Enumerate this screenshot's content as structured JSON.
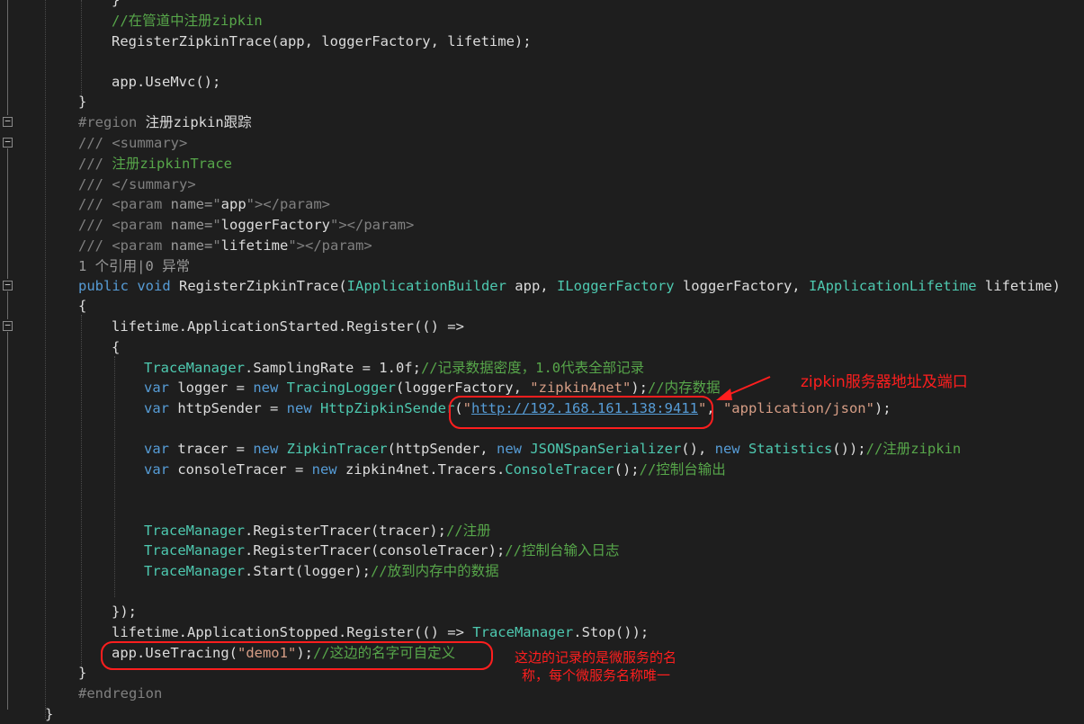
{
  "editor": {
    "lines": {
      "l0": "}",
      "l1": "//在管道中注册zipkin",
      "l2_a": "RegisterZipkinTrace(app, loggerFactory, lifetime);",
      "l4": "app.UseMvc();",
      "l5": "}",
      "l6_kw": "#region ",
      "l6_text": "注册zipkin跟踪",
      "l7_pre": "/// ",
      "l7_tag": "<summary>",
      "l8_pre": "/// ",
      "l8_text": "注册zipkinTrace",
      "l9_pre": "/// ",
      "l9_tag": "</summary>",
      "l10_pre": "/// ",
      "l10_a": "<param ",
      "l10_b": "name=",
      "l10_c": "\"",
      "l10_d": "app",
      "l10_e": "\"",
      "l10_f": "></param>",
      "l11_pre": "/// ",
      "l11_a": "<param ",
      "l11_b": "name=",
      "l11_c": "\"",
      "l11_d": "loggerFactory",
      "l11_e": "\"",
      "l11_f": "></param>",
      "l12_pre": "/// ",
      "l12_a": "<param ",
      "l12_b": "name=",
      "l12_c": "\"",
      "l12_d": "lifetime",
      "l12_e": "\"",
      "l12_f": "></param>",
      "codelens": "1 个引用|0 异常",
      "l14_pub": "public",
      "l14_void": "void",
      "l14_name": "RegisterZipkinTrace(",
      "l14_t1": "IApplicationBuilder",
      "l14_p1": " app, ",
      "l14_t2": "ILoggerFactory",
      "l14_p2": " loggerFactory, ",
      "l14_t3": "IApplicationLifetime",
      "l14_p3": " lifetime)",
      "l15": "{",
      "l16": "lifetime.ApplicationStarted.Register(() =>",
      "l17": "{",
      "l18_t": "TraceManager",
      "l18_a": ".SamplingRate = 1.0f;",
      "l18_c": "//记录数据密度，1.0代表全部记录",
      "l19_var": "var",
      "l19_a": " logger = ",
      "l19_new": "new",
      "l19_t": " TracingLogger",
      "l19_b": "(loggerFactory, ",
      "l19_s": "\"zipkin4net\"",
      "l19_e": ");",
      "l19_c": "//内存数据",
      "l20_var": "var",
      "l20_a": " httpSender = ",
      "l20_new": "new",
      "l20_t": " HttpZipkinSender",
      "l20_b": "(",
      "l20_q1": "\"",
      "l20_url": "http://192.168.161.138:9411",
      "l20_q2": "\"",
      "l20_m": ", ",
      "l20_s": "\"application/json\"",
      "l20_e": ");",
      "l22_var": "var",
      "l22_a": " tracer = ",
      "l22_new": "new",
      "l22_t": " ZipkinTracer",
      "l22_b": "(httpSender, ",
      "l22_new2": "new",
      "l22_t2": " JSONSpanSerializer",
      "l22_c": "(), ",
      "l22_new3": "new",
      "l22_t3": " Statistics",
      "l22_d": "());",
      "l22_cm": "//注册zipkin",
      "l23_var": "var",
      "l23_a": " consoleTracer = ",
      "l23_new": "new",
      "l23_b": " zipkin4net.Tracers.",
      "l23_t": "ConsoleTracer",
      "l23_c": "();",
      "l23_cm": "//控制台输出",
      "l26_t": "TraceManager",
      "l26_a": ".RegisterTracer(tracer);",
      "l26_c": "//注册",
      "l27_t": "TraceManager",
      "l27_a": ".RegisterTracer(consoleTracer);",
      "l27_c": "//控制台输入日志",
      "l28_t": "TraceManager",
      "l28_a": ".Start(logger);",
      "l28_c": "//放到内存中的数据",
      "l30": "});",
      "l31_a": "lifetime.ApplicationStopped.Register(() => ",
      "l31_t": "TraceManager",
      "l31_b": ".Stop());",
      "l32_a": "app.UseTracing(",
      "l32_s": "\"demo1\"",
      "l32_b": ");",
      "l32_c": "//这边的名字可自定义",
      "l33": "}",
      "l34": "#endregion",
      "l35": "}"
    }
  },
  "annotations": {
    "zipkin_label": "zipkin服务器地址及端口",
    "note_line1": "这边的记录的是微服务的名",
    "note_line2": "称，每个微服务名称唯一"
  },
  "colors": {
    "background": "#1e1e1e",
    "keyword": "#569cd6",
    "type": "#4ec9b0",
    "comment": "#57a64a",
    "string": "#d69d85",
    "annotation": "#ff1e1e"
  }
}
